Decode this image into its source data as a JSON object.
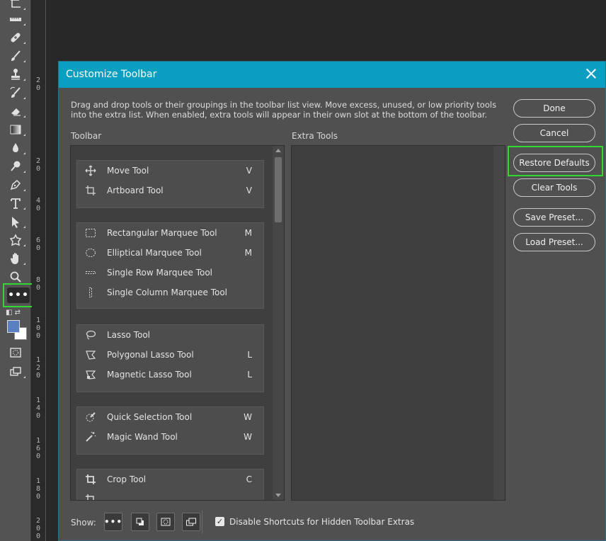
{
  "dialog": {
    "title": "Customize Toolbar",
    "description": "Drag and drop tools or their groupings in the toolbar list view. Move excess, unused, or low priority tools into the extra list. When enabled, extra tools will appear in their own slot at the bottom of the toolbar.",
    "toolbar_label": "Toolbar",
    "extra_label": "Extra Tools",
    "buttons": {
      "done": "Done",
      "cancel": "Cancel",
      "restore": "Restore Defaults",
      "clear": "Clear Tools",
      "save_preset": "Save Preset...",
      "load_preset": "Load Preset..."
    },
    "show_label": "Show:",
    "more_glyph": "•••",
    "shortcut_checkbox": {
      "label": "Disable Shortcuts for Hidden Toolbar Extras",
      "checked": true
    }
  },
  "tool_groups": [
    {
      "tools": [
        {
          "name": "Move Tool",
          "key": "V",
          "icon": "move-icon"
        },
        {
          "name": "Artboard Tool",
          "key": "V",
          "icon": "artboard-icon"
        }
      ]
    },
    {
      "tools": [
        {
          "name": "Rectangular Marquee Tool",
          "key": "M",
          "icon": "rect-marquee-icon"
        },
        {
          "name": "Elliptical Marquee Tool",
          "key": "M",
          "icon": "ellipse-marquee-icon"
        },
        {
          "name": "Single Row Marquee Tool",
          "key": "",
          "icon": "single-row-icon"
        },
        {
          "name": "Single Column Marquee Tool",
          "key": "",
          "icon": "single-column-icon"
        }
      ]
    },
    {
      "tools": [
        {
          "name": "Lasso Tool",
          "key": "",
          "icon": "lasso-icon"
        },
        {
          "name": "Polygonal Lasso Tool",
          "key": "L",
          "icon": "polygonal-lasso-icon"
        },
        {
          "name": "Magnetic Lasso Tool",
          "key": "L",
          "icon": "magnetic-lasso-icon"
        }
      ]
    },
    {
      "tools": [
        {
          "name": "Quick Selection Tool",
          "key": "W",
          "icon": "quick-selection-icon"
        },
        {
          "name": "Magic Wand Tool",
          "key": "W",
          "icon": "magic-wand-icon"
        }
      ]
    },
    {
      "tools": [
        {
          "name": "Crop Tool",
          "key": "C",
          "icon": "crop-icon"
        },
        {
          "name": "",
          "key": "",
          "icon": "perspective-crop-icon"
        }
      ]
    }
  ],
  "ruler": {
    "labels": [
      "2\n0",
      "4\n0",
      "6\n0",
      "8\n0",
      "1\n0\n0",
      "1\n2\n0",
      "1\n4\n0",
      "1\n6\n0",
      "1\n8\n0",
      "2\n0\n0"
    ]
  },
  "colors": {
    "titlebar": "#0a9fc1",
    "highlight": "#2fd92f",
    "foreground": "#5a7fc3",
    "background": "#ffffff"
  }
}
